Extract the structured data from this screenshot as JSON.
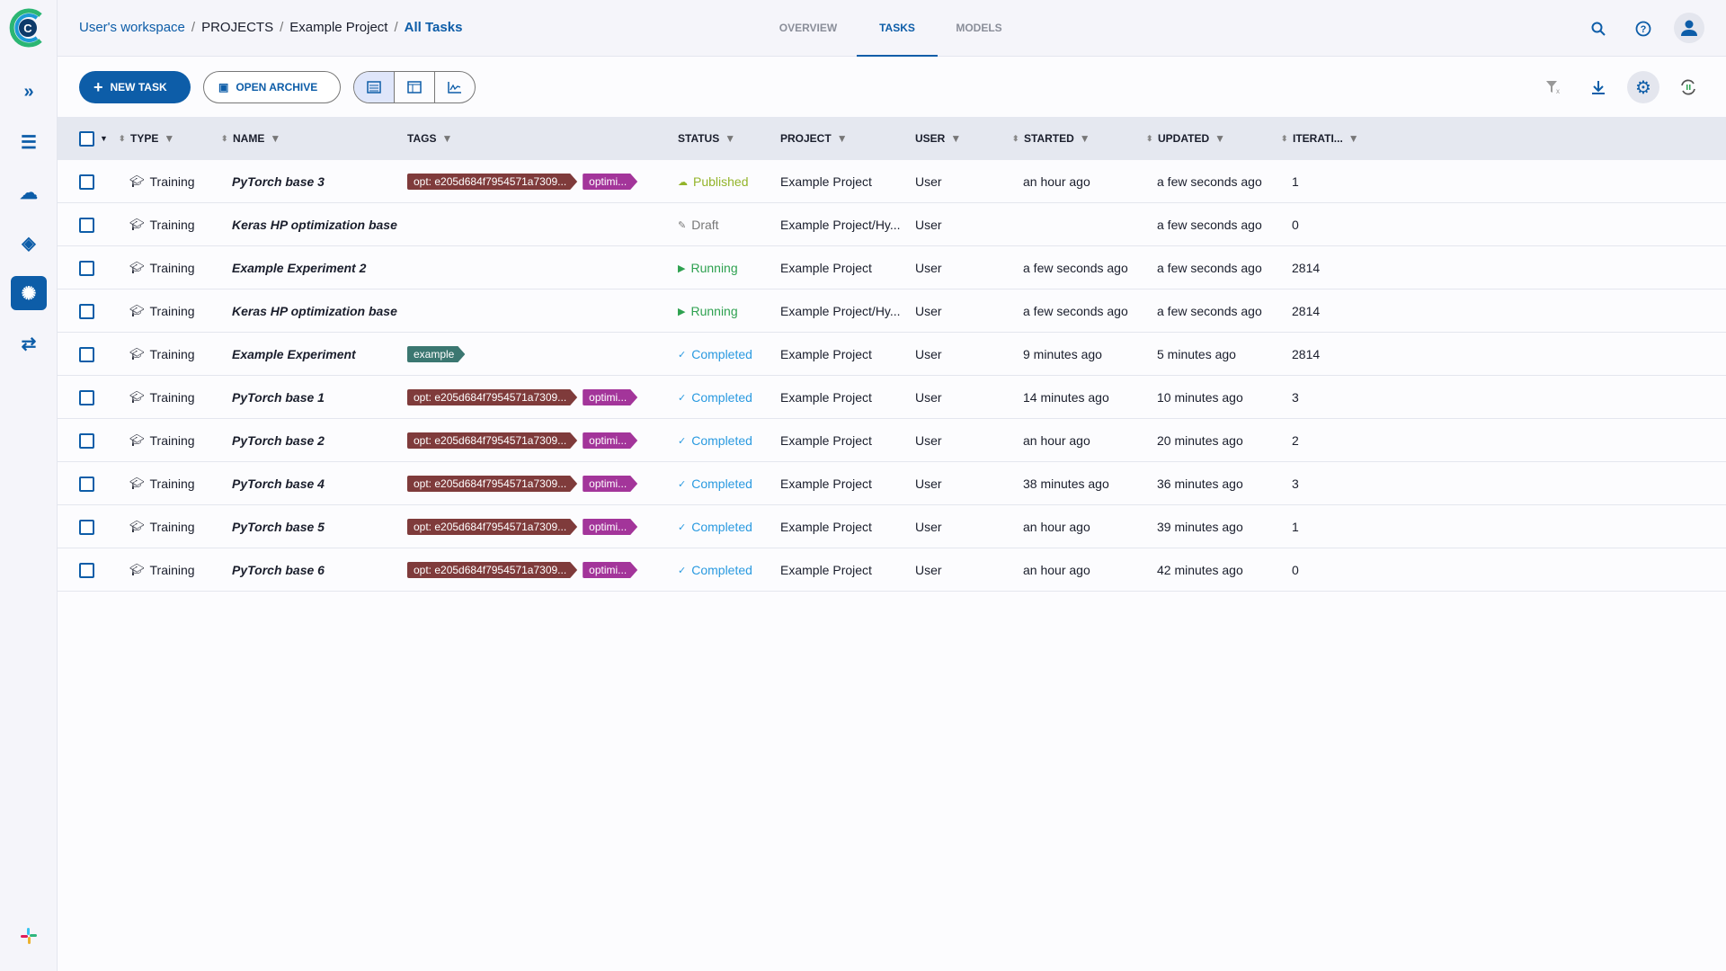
{
  "header": {
    "breadcrumb": [
      "User's workspace",
      "PROJECTS",
      "Example Project",
      "All Tasks"
    ],
    "tabs": [
      {
        "label": "OVERVIEW",
        "active": false
      },
      {
        "label": "TASKS",
        "active": true
      },
      {
        "label": "MODELS",
        "active": false
      }
    ]
  },
  "sidebar": {
    "items": [
      "pipelines-icon",
      "workers-icon",
      "autoscaler-icon",
      "datasets-icon",
      "experiments-icon",
      "orchestration-icon"
    ],
    "active": "experiments-icon"
  },
  "toolbar": {
    "new_task": "NEW TASK",
    "open_archive": "OPEN ARCHIVE",
    "views": [
      "table-view",
      "details-view",
      "compare-view"
    ],
    "active_view": "table-view"
  },
  "columns": [
    "TYPE",
    "NAME",
    "TAGS",
    "STATUS",
    "PROJECT",
    "USER",
    "STARTED",
    "UPDATED",
    "ITERATI..."
  ],
  "colors": {
    "accent": "#0d5da8",
    "tag_opt": "#7f3b3b",
    "tag_optimi": "#a3359a",
    "tag_example": "#3b7771",
    "published": "#93b42a",
    "running": "#2ea150",
    "completed": "#2a9ae0",
    "draft": "#777777"
  },
  "rows": [
    {
      "type": "Training",
      "name": "PyTorch base 3",
      "tags": [
        "opt: e205d684f7954571a7309...",
        "optimi..."
      ],
      "status": "Published",
      "project": "Example Project",
      "user": "User",
      "started": "an hour ago",
      "updated": "a few seconds ago",
      "iterations": "1"
    },
    {
      "type": "Training",
      "name": "Keras HP optimization base",
      "tags": [],
      "status": "Draft",
      "project": "Example Project/Hy...",
      "user": "User",
      "started": "",
      "updated": "a few seconds ago",
      "iterations": "0"
    },
    {
      "type": "Training",
      "name": "Example Experiment 2",
      "tags": [],
      "status": "Running",
      "project": "Example Project",
      "user": "User",
      "started": "a few seconds ago",
      "updated": "a few seconds ago",
      "iterations": "2814"
    },
    {
      "type": "Training",
      "name": "Keras HP optimization base",
      "tags": [],
      "status": "Running",
      "project": "Example Project/Hy...",
      "user": "User",
      "started": "a few seconds ago",
      "updated": "a few seconds ago",
      "iterations": "2814"
    },
    {
      "type": "Training",
      "name": "Example Experiment",
      "tags": [
        "example"
      ],
      "status": "Completed",
      "project": "Example Project",
      "user": "User",
      "started": "9 minutes ago",
      "updated": "5 minutes ago",
      "iterations": "2814"
    },
    {
      "type": "Training",
      "name": "PyTorch base 1",
      "tags": [
        "opt: e205d684f7954571a7309...",
        "optimi..."
      ],
      "status": "Completed",
      "project": "Example Project",
      "user": "User",
      "started": "14 minutes ago",
      "updated": "10 minutes ago",
      "iterations": "3"
    },
    {
      "type": "Training",
      "name": "PyTorch base 2",
      "tags": [
        "opt: e205d684f7954571a7309...",
        "optimi..."
      ],
      "status": "Completed",
      "project": "Example Project",
      "user": "User",
      "started": "an hour ago",
      "updated": "20 minutes ago",
      "iterations": "2"
    },
    {
      "type": "Training",
      "name": "PyTorch base 4",
      "tags": [
        "opt: e205d684f7954571a7309...",
        "optimi..."
      ],
      "status": "Completed",
      "project": "Example Project",
      "user": "User",
      "started": "38 minutes ago",
      "updated": "36 minutes ago",
      "iterations": "3"
    },
    {
      "type": "Training",
      "name": "PyTorch base 5",
      "tags": [
        "opt: e205d684f7954571a7309...",
        "optimi..."
      ],
      "status": "Completed",
      "project": "Example Project",
      "user": "User",
      "started": "an hour ago",
      "updated": "39 minutes ago",
      "iterations": "1"
    },
    {
      "type": "Training",
      "name": "PyTorch base 6",
      "tags": [
        "opt: e205d684f7954571a7309...",
        "optimi..."
      ],
      "status": "Completed",
      "project": "Example Project",
      "user": "User",
      "started": "an hour ago",
      "updated": "42 minutes ago",
      "iterations": "0"
    }
  ]
}
